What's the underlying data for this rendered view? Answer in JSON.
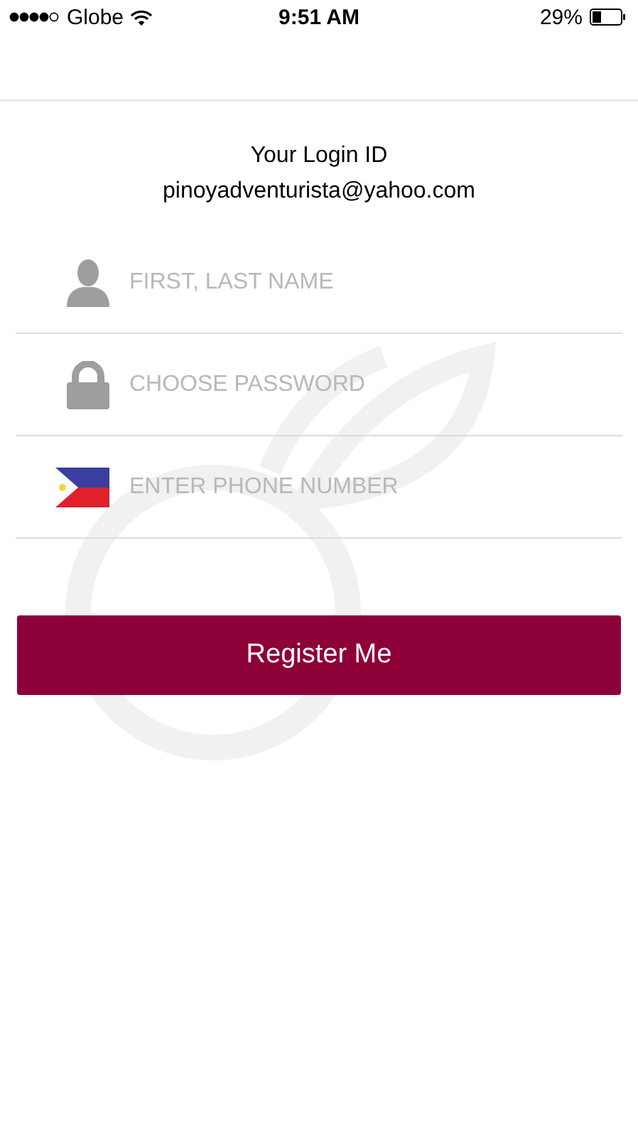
{
  "status_bar": {
    "carrier": "Globe",
    "time": "9:51 AM",
    "battery": "29%"
  },
  "login": {
    "label": "Your Login ID",
    "email": "pinoyadventurista@yahoo.com"
  },
  "fields": [
    {
      "kind": "person",
      "placeholder": "FIRST, LAST NAME"
    },
    {
      "kind": "lock",
      "placeholder": "CHOOSE PASSWORD"
    },
    {
      "kind": "flag",
      "placeholder": "ENTER PHONE NUMBER"
    }
  ],
  "button": "Register Me"
}
